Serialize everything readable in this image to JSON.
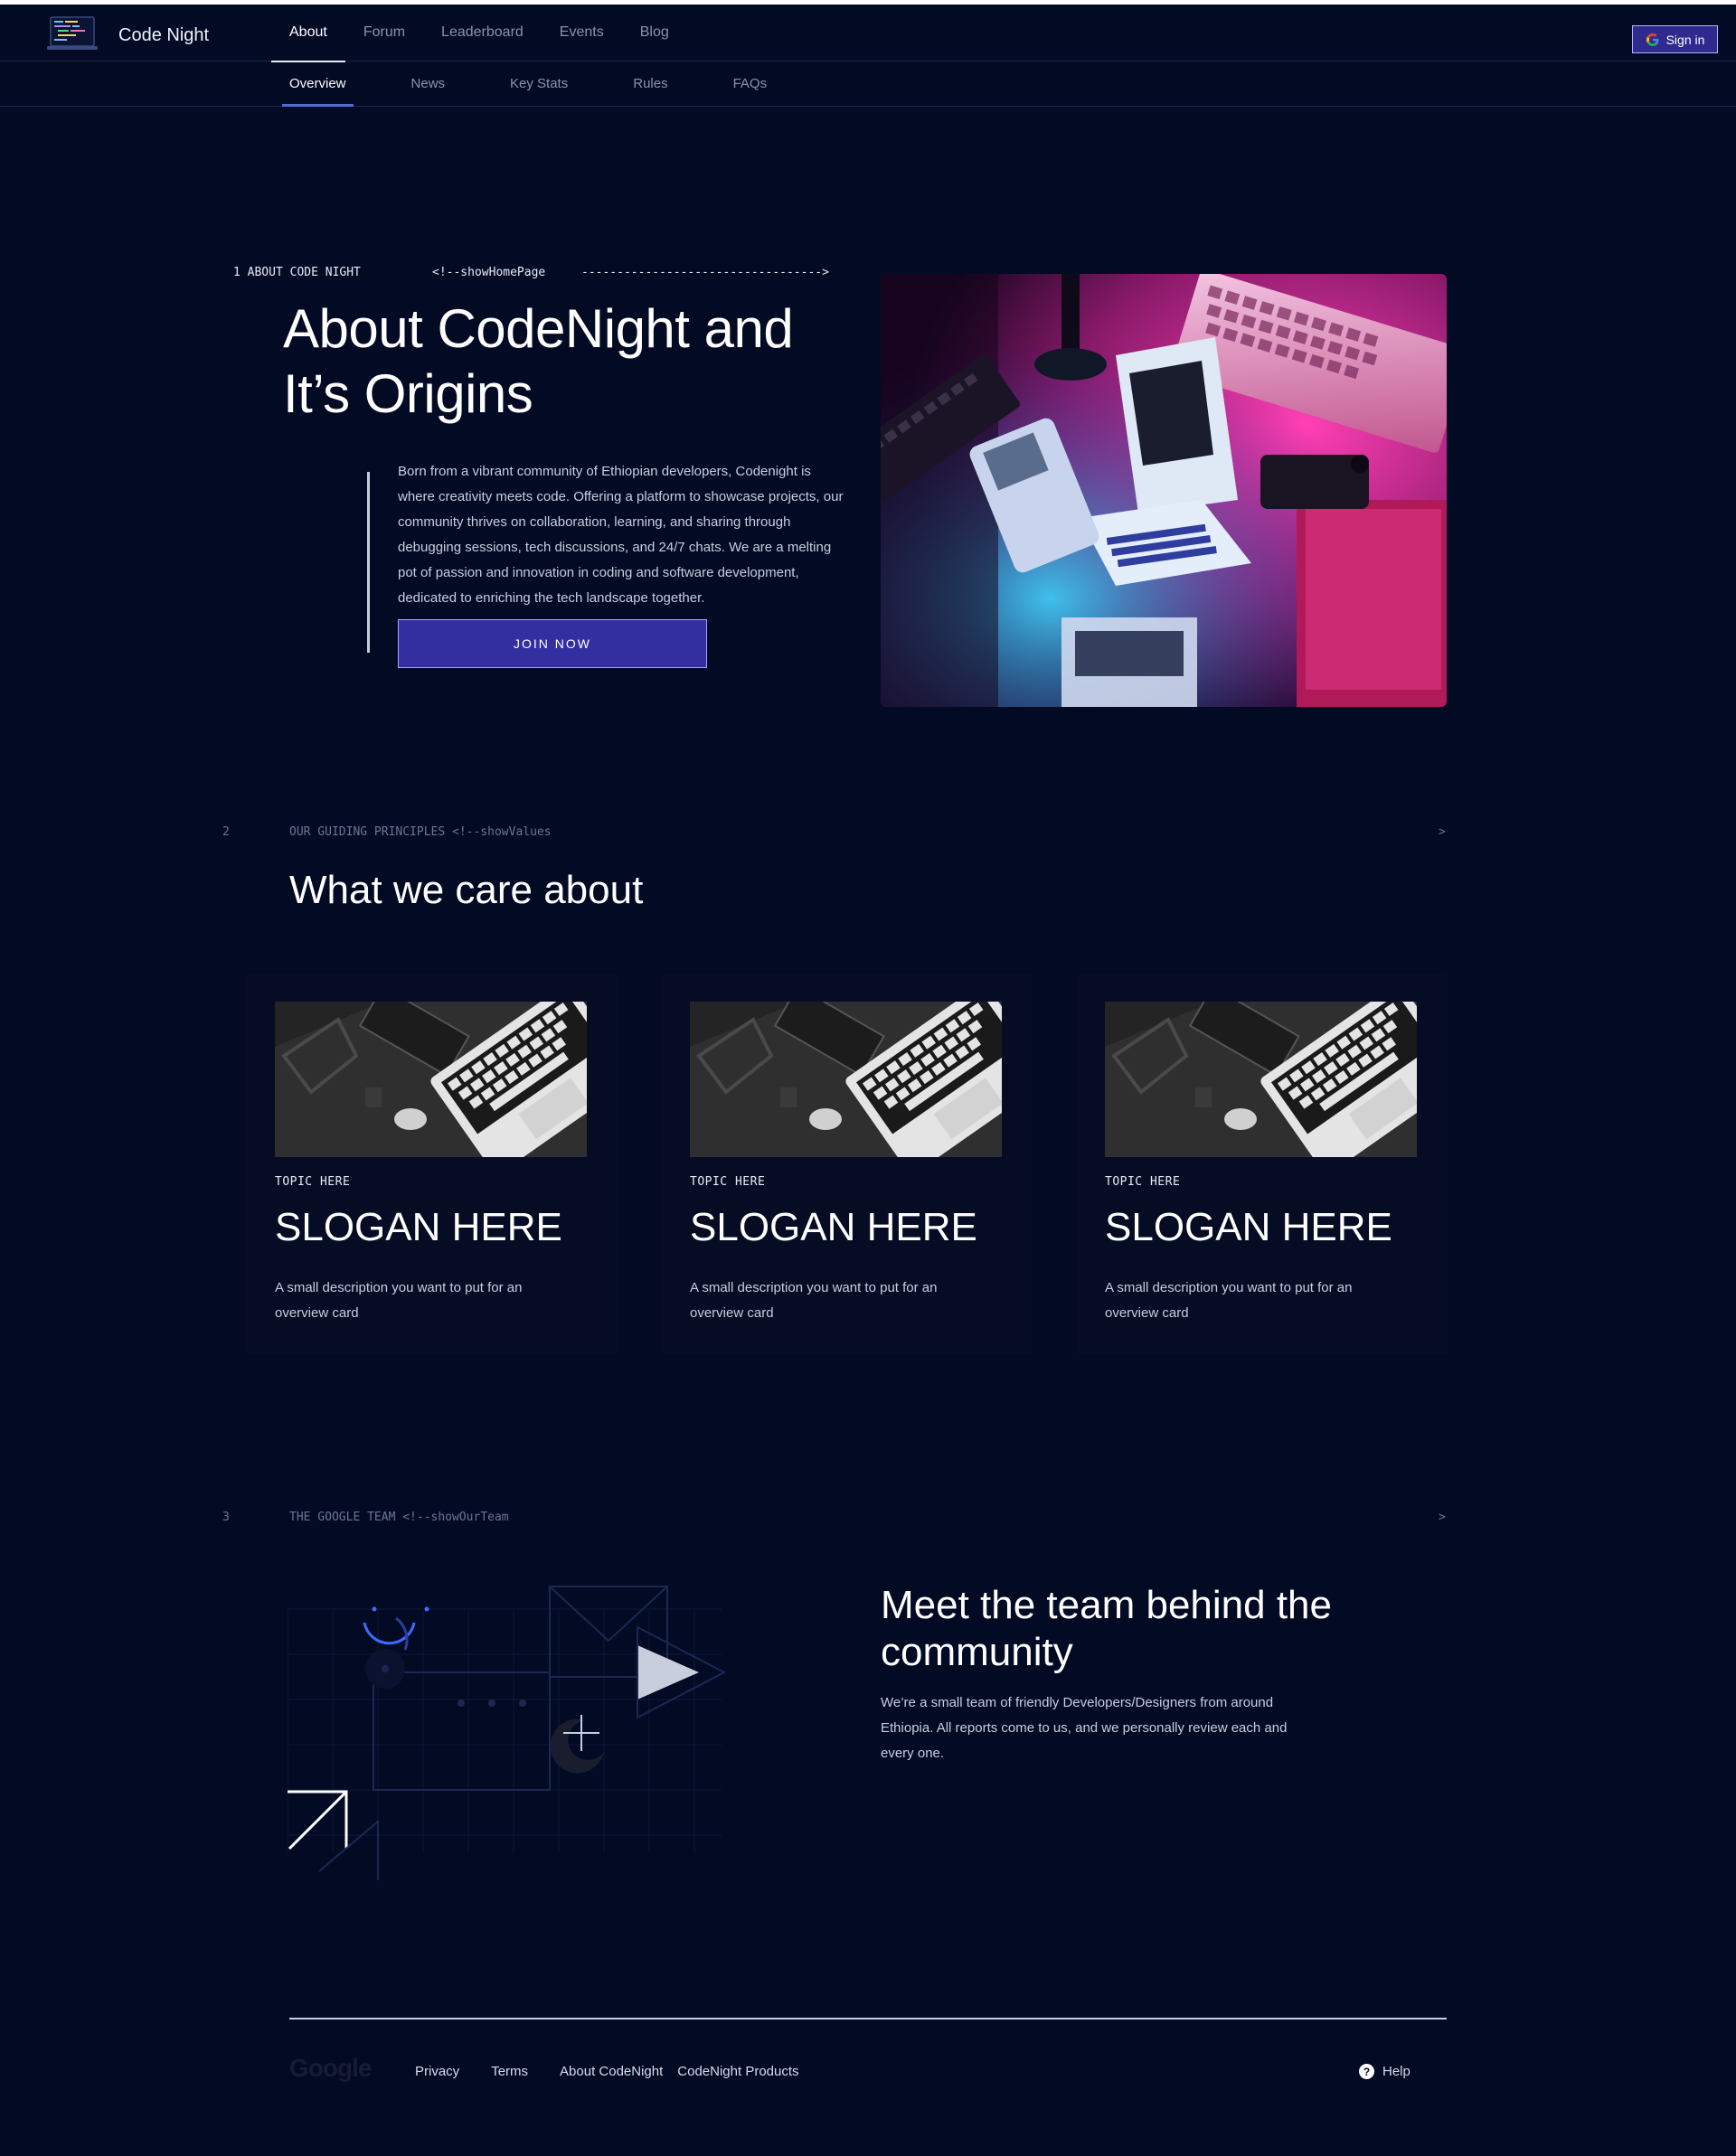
{
  "header": {
    "brand": "Code Night",
    "nav": [
      "About",
      "Forum",
      "Leaderboard",
      "Events",
      "Blog"
    ],
    "active_nav": "About",
    "sign_in_label": "Sign in"
  },
  "subnav": {
    "items": [
      "Overview",
      "News",
      "Key Stats",
      "Rules",
      "FAQs"
    ],
    "active": "Overview"
  },
  "hero": {
    "section_label": "1 ABOUT CODE NIGHT",
    "comment": "<!--showHomePage",
    "dash_arrow": "---------------------------------->",
    "title_line1": "About CodeNight and",
    "title_line2": "It’s Origins",
    "body": "Born from a vibrant community of Ethiopian developers, Codenight is where creativity meets code. Offering a platform to showcase projects, our community thrives on collaboration, learning, and sharing through debugging sessions, tech discussions, and 24/7 chats. We are a melting pot of passion and innovation in coding and software development, dedicated to enriching the tech landscape together.",
    "cta": "JOIN NOW"
  },
  "values": {
    "number": "2",
    "label": "OUR GUIDING PRINCIPLES <!--showValues",
    "arrow": ">",
    "title": "What we care about",
    "cards": [
      {
        "topic": "TOPIC HERE",
        "slogan": "SLOGAN HERE",
        "desc": "A small  description you want to put for an overview card"
      },
      {
        "topic": "TOPIC HERE",
        "slogan": "SLOGAN HERE",
        "desc": "A small  description you want to put for an overview card"
      },
      {
        "topic": "TOPIC HERE",
        "slogan": "SLOGAN HERE",
        "desc": "A small  description you want to put for an overview card"
      }
    ]
  },
  "team": {
    "number": "3",
    "label": "THE GOOGLE TEAM <!--showOurTeam",
    "arrow": ">",
    "title": "Meet the team behind the community",
    "text": "We’re a small team of friendly  Developers/Designers from around Ethiopia. All reports come to us, and we personally review each and every one."
  },
  "footer": {
    "logo": "Google",
    "links": [
      "Privacy",
      "Terms",
      "About CodeNight",
      "CodeNight Products"
    ],
    "help": "Help"
  },
  "colors": {
    "background": "#020a24",
    "accent": "#342fa0",
    "tab_underline": "#4f6bd8"
  }
}
